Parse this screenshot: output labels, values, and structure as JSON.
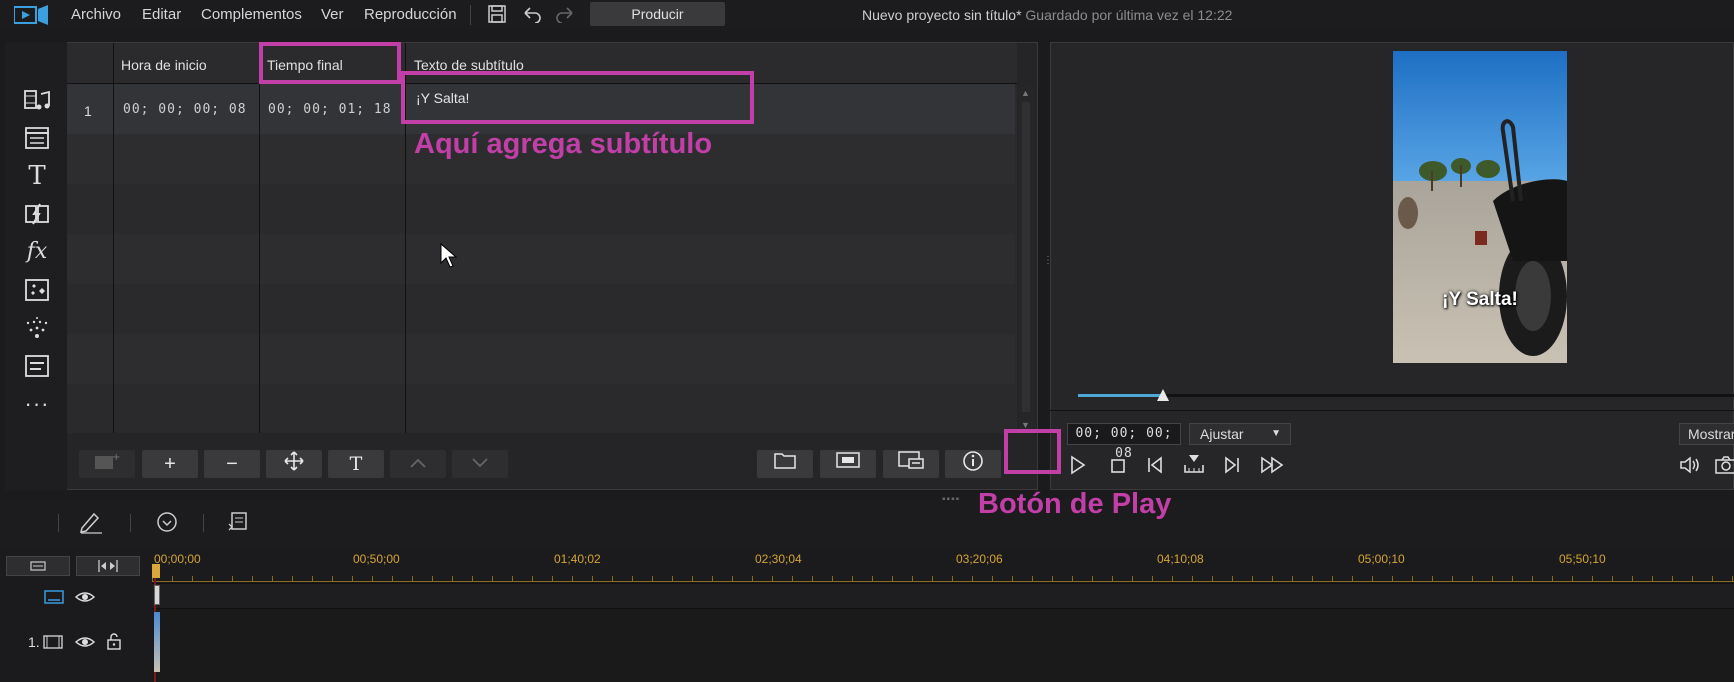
{
  "menu": {
    "items": [
      "Archivo",
      "Editar",
      "Complementos",
      "Ver",
      "Reproducción"
    ],
    "produce_label": "Producir",
    "project_title": "Nuevo proyecto sin título*",
    "saved_text": "Guardado por última vez el 12:22"
  },
  "subtitle_table": {
    "columns": [
      "Hora de inicio",
      "Tiempo final",
      "Texto de subtítulo"
    ],
    "rows": [
      {
        "index": "1",
        "start": "00; 00; 00; 08",
        "end": "00; 00; 01; 18",
        "text": "¡Y Salta!"
      }
    ]
  },
  "preview": {
    "overlay_subtitle": "¡Y Salta!",
    "timecode": "00; 00; 00; 08",
    "fit_label": "Ajustar",
    "show_label": "Mostrar",
    "progress": 0.13
  },
  "timeline": {
    "ticks": [
      "00;00;00",
      "00;50;00",
      "01;40;02",
      "02;30;04",
      "03;20;06",
      "04;10;08",
      "05;00;10",
      "05;50;10"
    ],
    "track_label": "1."
  },
  "annotations": {
    "subtitle_hint": "Aquí agrega subtítulo",
    "play_hint": "Botón de Play"
  },
  "colors": {
    "annotation": "#c23fa8",
    "ruler": "#d4a436",
    "progress": "#4fa9d8"
  }
}
